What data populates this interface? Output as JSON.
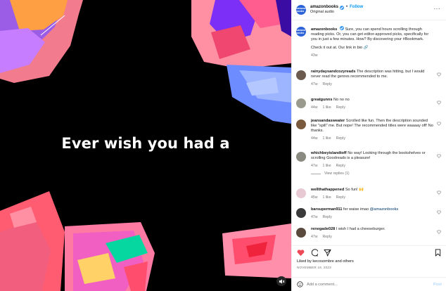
{
  "media": {
    "overlay_text": "Ever wish you had a"
  },
  "header": {
    "username": "amazonbooks",
    "follow_label": "Follow",
    "subtitle": "Original audio",
    "avatar_text": "amazon books"
  },
  "caption": {
    "username": "amazonbooks",
    "text": "Sure, you can spend hours scrolling through reading picks. Or, you can get editor-approved picks, specifically for you in just a few minutes. How? By discovering your #Bookmark.",
    "text2": "Check it out at. Our link in bio 🔗",
    "time": "43w"
  },
  "comments": [
    {
      "username": "rainydaysandcozyreads",
      "text": "The description was hitting, but I would never read the genres recommended to me.",
      "time": "47w",
      "likes": "",
      "reply": "Reply"
    },
    {
      "username": "greatgunns",
      "text": "No no no",
      "time": "44w",
      "likes": "1 like",
      "reply": "Reply"
    },
    {
      "username": "jeansandasweater",
      "text": "Scrolled like fun. Then the description sounded like \"spill\" me. But nope! The recommended titles were waaaay off! No thanks.",
      "time": "44w",
      "likes": "1 like",
      "reply": "Reply"
    },
    {
      "username": "whichbeyislandtoff",
      "text": "No way! Looking through the bookshelves or scrolling Goodreads is a pleasure!",
      "time": "47w",
      "likes": "1 like",
      "reply": "Reply",
      "view_replies": "View replies (1)"
    },
    {
      "username": "wellthathappened",
      "text": "So fun! 🙌",
      "time": "45w",
      "likes": "1 like",
      "reply": "Reply"
    },
    {
      "username": "barsuperman911",
      "text": "fer waise imao",
      "mention": "@amazonbooks",
      "time": "47w",
      "likes": "",
      "reply": "Reply"
    },
    {
      "username": "renegade028",
      "text": "I wish I had a cheeseburger.",
      "time": "47w",
      "likes": "",
      "reply": "Reply"
    }
  ],
  "actions": {
    "likes_text": "Liked by kecosombre and others",
    "date": "NOVEMBER 18, 2023"
  },
  "add_comment": {
    "placeholder": "Add a comment...",
    "post_label": "Post"
  }
}
